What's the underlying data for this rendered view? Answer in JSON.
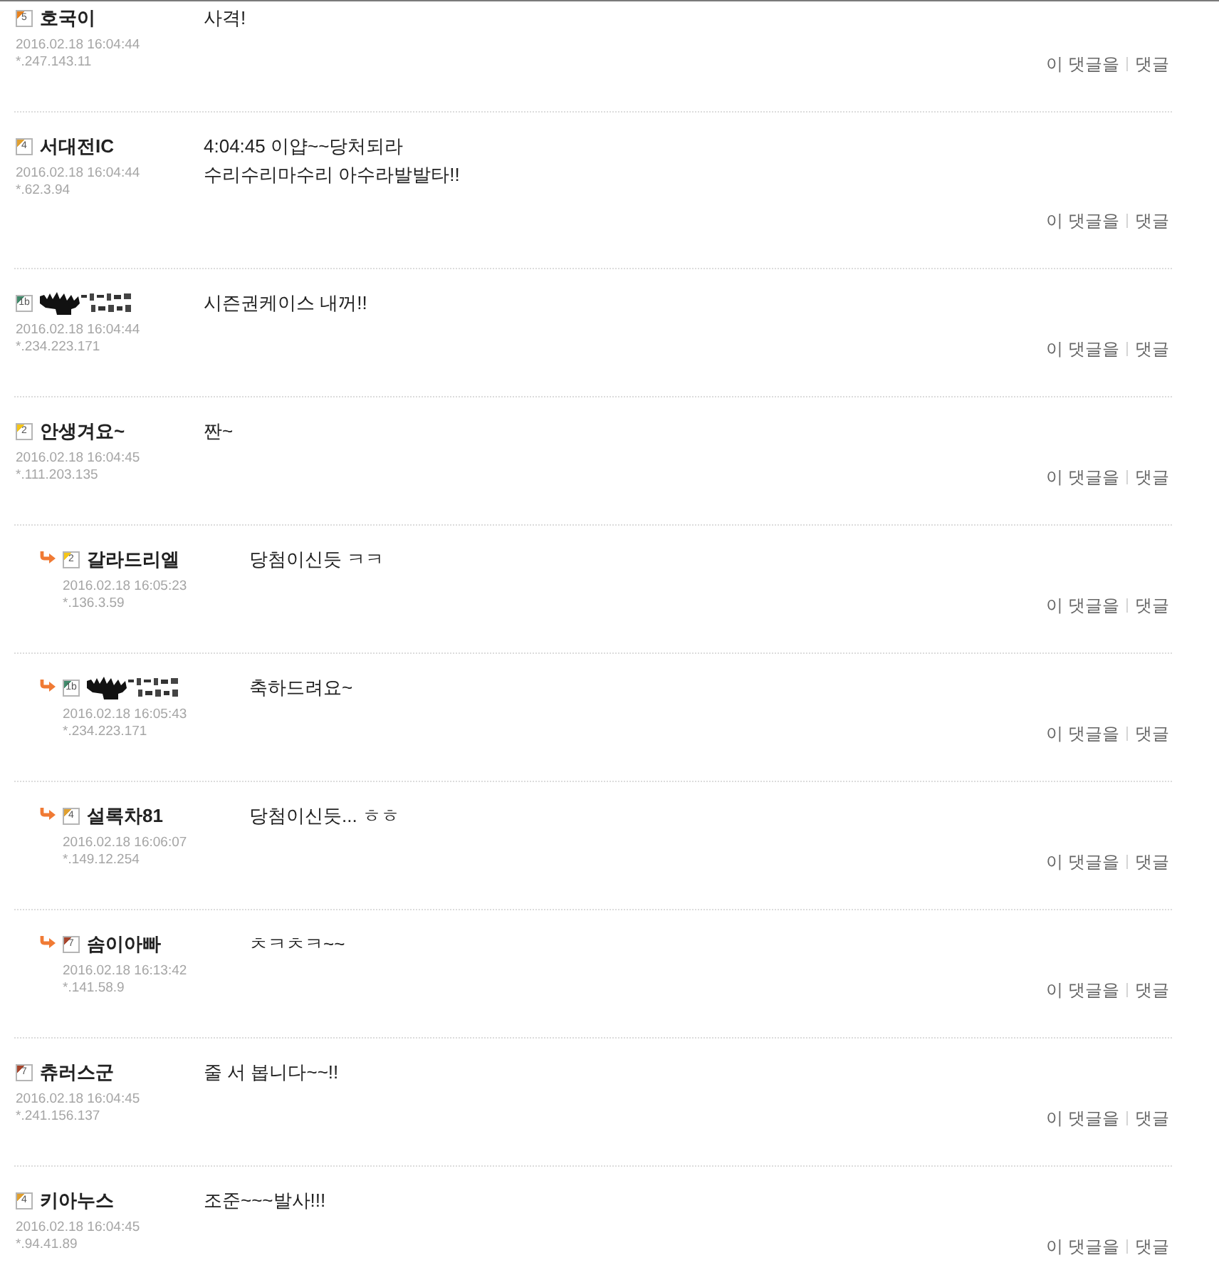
{
  "comments": [
    {
      "badge": {
        "label": "5",
        "color": "#e8821e"
      },
      "author": {
        "kind": "text",
        "name": "호국이"
      },
      "date": "2016.02.18 16:04:44",
      "ip": "*.247.143.11",
      "lines": [
        "사격!"
      ],
      "actions": [
        "이 댓글을",
        "댓글"
      ]
    },
    {
      "badge": {
        "label": "4",
        "color": "#e0a030"
      },
      "author": {
        "kind": "text",
        "name": "서대전IC"
      },
      "date": "2016.02.18 16:04:44",
      "ip": "*.62.3.94",
      "lines": [
        "4:04:45 이얍~~당처되라",
        "수리수리마수리 아수라발발타!!"
      ],
      "actions": [
        "이 댓글을",
        "댓글"
      ]
    },
    {
      "badge": {
        "label": "1b",
        "color": "#3f8a6a"
      },
      "author": {
        "kind": "image"
      },
      "date": "2016.02.18 16:04:44",
      "ip": "*.234.223.171",
      "lines": [
        "시즌권케이스 내꺼!!"
      ],
      "actions": [
        "이 댓글을",
        "댓글"
      ]
    },
    {
      "badge": {
        "label": "2",
        "color": "#f5c518"
      },
      "author": {
        "kind": "text",
        "name": "안생겨요~"
      },
      "date": "2016.02.18 16:04:45",
      "ip": "*.111.203.135",
      "lines": [
        "짠~"
      ],
      "actions": [
        "이 댓글을",
        "댓글"
      ],
      "children": [
        {
          "badge": {
            "label": "2",
            "color": "#f5c518"
          },
          "author": {
            "kind": "text",
            "name": "갈라드리엘"
          },
          "date": "2016.02.18 16:05:23",
          "ip": "*.136.3.59",
          "lines": [
            "당첨이신듯 ㅋㅋ"
          ],
          "actions": [
            "이 댓글을",
            "댓글"
          ]
        },
        {
          "badge": {
            "label": "1b",
            "color": "#3f8a6a"
          },
          "author": {
            "kind": "image"
          },
          "date": "2016.02.18 16:05:43",
          "ip": "*.234.223.171",
          "lines": [
            "축하드려요~"
          ],
          "actions": [
            "이 댓글을",
            "댓글"
          ]
        },
        {
          "badge": {
            "label": "4",
            "color": "#e0a030"
          },
          "author": {
            "kind": "text",
            "name": "설록차81"
          },
          "date": "2016.02.18 16:06:07",
          "ip": "*.149.12.254",
          "lines": [
            "당첨이신듯... ㅎㅎ"
          ],
          "actions": [
            "이 댓글을",
            "댓글"
          ]
        },
        {
          "badge": {
            "label": "7",
            "color": "#a8452c"
          },
          "author": {
            "kind": "text",
            "name": "솜이아빠"
          },
          "date": "2016.02.18 16:13:42",
          "ip": "*.141.58.9",
          "lines": [
            "ㅊㅋㅊㅋ~~"
          ],
          "actions": [
            "이 댓글을",
            "댓글"
          ]
        }
      ]
    },
    {
      "badge": {
        "label": "7",
        "color": "#a8452c"
      },
      "author": {
        "kind": "text",
        "name": "츄러스군"
      },
      "date": "2016.02.18 16:04:45",
      "ip": "*.241.156.137",
      "lines": [
        "줄 서 봅니다~~!!"
      ],
      "actions": [
        "이 댓글을",
        "댓글"
      ]
    },
    {
      "badge": {
        "label": "4",
        "color": "#e0a030"
      },
      "author": {
        "kind": "text",
        "name": "키아누스"
      },
      "date": "2016.02.18 16:04:45",
      "ip": "*.94.41.89",
      "lines": [
        "조준~~~발사!!!"
      ],
      "actions": [
        "이 댓글을",
        "댓글"
      ]
    }
  ]
}
